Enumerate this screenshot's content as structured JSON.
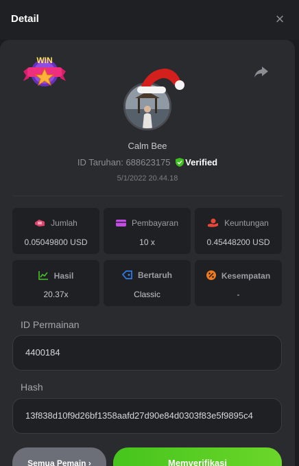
{
  "header": {
    "title": "Detail",
    "close_icon": "close-icon"
  },
  "profile": {
    "username": "Calm Bee",
    "bet_id_label": "ID Taruhan:",
    "bet_id": "688623175",
    "verified_label": "Verified",
    "date": "5/1/2022 20.44.18",
    "badge_text": "WIN"
  },
  "stats": [
    {
      "label": "Jumlah",
      "value": "0.05049800 USD",
      "icon": "bet-amount-icon",
      "color": "#e0446c"
    },
    {
      "label": "Pembayaran",
      "value": "10 x",
      "icon": "card-icon",
      "color": "#c04ee0"
    },
    {
      "label": "Keuntungan",
      "value": "0.45448200 USD",
      "icon": "profit-hand-icon",
      "color": "#e8473a"
    },
    {
      "label": "Hasil",
      "value": "20.37x",
      "icon": "chart-icon",
      "color": "#48c22a"
    },
    {
      "label": "Bertaruh",
      "value": "Classic",
      "icon": "tag-icon",
      "color": "#2f7dea"
    },
    {
      "label": "Kesempatan",
      "value": "-",
      "icon": "percent-icon",
      "color": "#f07a1e"
    }
  ],
  "fields": {
    "game_id_label": "ID Permainan",
    "game_id": "4400184",
    "hash_label": "Hash",
    "hash": "13f838d10f9d26bf1358aafd27d90e84d0303f83e5f9895c4"
  },
  "actions": {
    "all_players": "Semua Pemain ›",
    "verify": "Memverifikasi"
  },
  "colors": {
    "accent_green": "#4cc91f",
    "background": "#1b1c1f",
    "card": "#2a2b2f"
  }
}
